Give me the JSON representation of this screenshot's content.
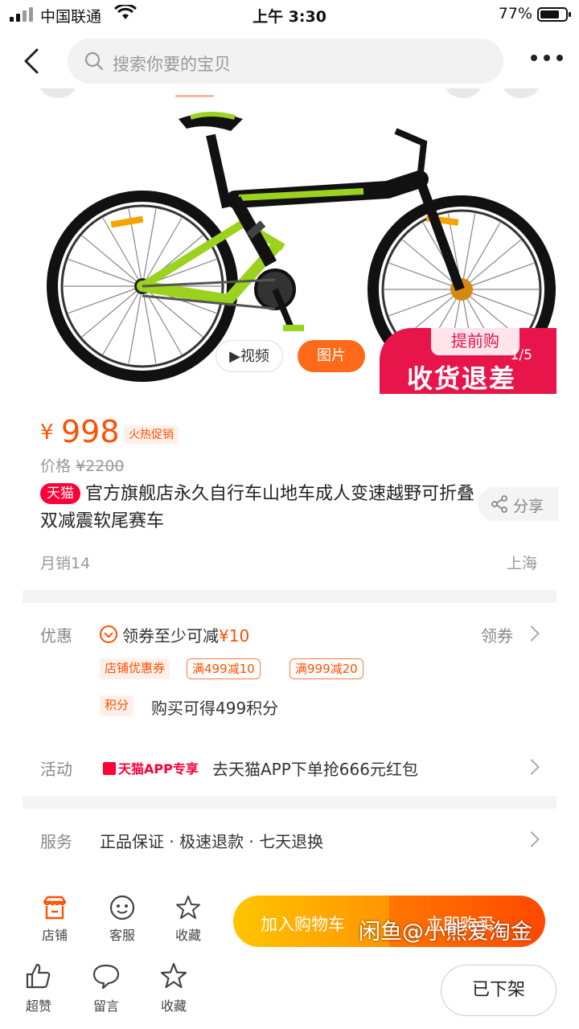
{
  "status_bar": {
    "carrier": "中国联通",
    "time": "上午 3:30",
    "battery": "77%",
    "battery_level": 0.77
  },
  "nav": {
    "search_placeholder": "搜索你要的宝贝"
  },
  "gallery": {
    "video_label": "视频",
    "photo_label": "图片",
    "promo_tag": "提前购",
    "promo_text": "收货退差",
    "counter": "1/5"
  },
  "product": {
    "currency": "¥",
    "price": "998",
    "hot_tag": "火热促销",
    "orig_label": "价格",
    "orig_price": "¥2200",
    "brand_tag": "天猫",
    "title": "官方旗舰店永久自行车山地车成人变速越野可折叠双减震软尾赛车",
    "share": "分享",
    "monthly_sales": "月销14",
    "location": "上海"
  },
  "promotions": {
    "label": "优惠",
    "coupon_text": "领券至少可减",
    "coupon_amount": "¥10",
    "get_coupon": "领券",
    "store_coupon_tag": "店铺优惠券",
    "coupons": [
      "满499减10",
      "满999减20"
    ],
    "points_tag": "积分",
    "points_text": "购买可得499积分"
  },
  "activity": {
    "label": "活动",
    "tag": "天猫APP专享",
    "text": "去天猫APP下单抢666元红包"
  },
  "service": {
    "label": "服务",
    "text": "正品保证 · 极速退款 · 七天退换"
  },
  "action_bar": {
    "store": "店铺",
    "service": "客服",
    "favorite": "收藏",
    "add_to_cart": "加入购物车",
    "buy_now": "立即购买",
    "watermark": "闲鱼@小熊爱淘金"
  },
  "bottom_bar": {
    "like": "超赞",
    "comment": "留言",
    "favorite": "收藏",
    "off_shelf": "已下架"
  },
  "colors": {
    "accent": "#ff5000",
    "tmall_red": "#ff0036",
    "bike_green": "#9bd21e"
  }
}
